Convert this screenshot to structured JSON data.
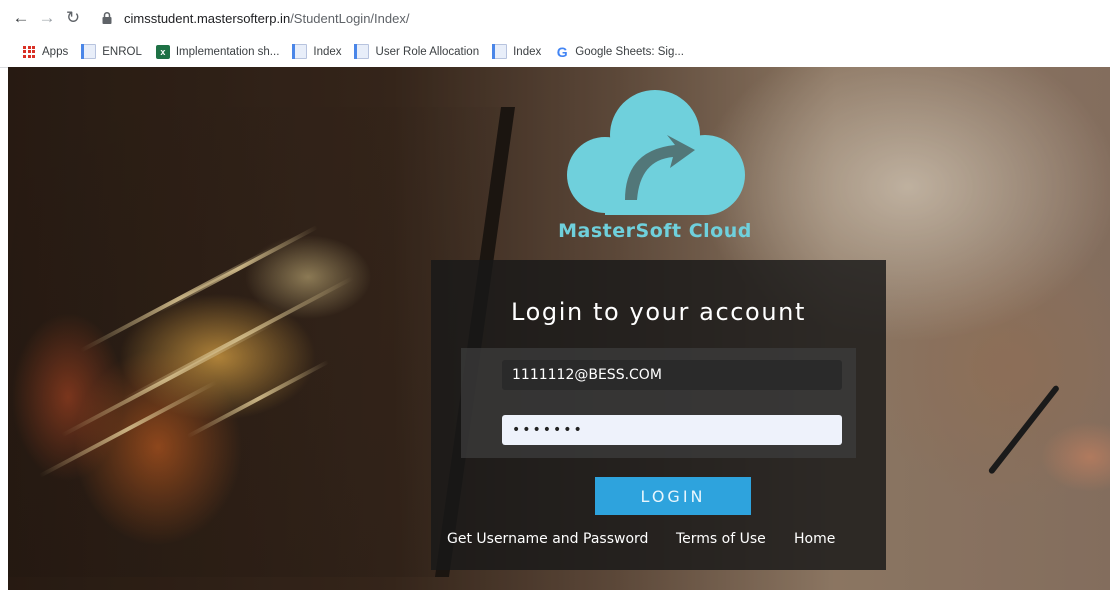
{
  "browser": {
    "url_host": "cimsstudent.mastersofterp.in",
    "url_path": "/StudentLogin/Index/"
  },
  "bookmarks": [
    {
      "label": "Apps",
      "icon": "apps-grid-icon"
    },
    {
      "label": "ENROL",
      "icon": "document-icon"
    },
    {
      "label": "Implementation sh...",
      "icon": "excel-icon"
    },
    {
      "label": "Index",
      "icon": "document-icon"
    },
    {
      "label": "User Role Allocation",
      "icon": "document-icon"
    },
    {
      "label": "Index",
      "icon": "document-icon"
    },
    {
      "label": "Google Sheets: Sig...",
      "icon": "google-icon"
    }
  ],
  "brand": {
    "name": "MasterSoft Cloud",
    "color": "#6fd0dc"
  },
  "login": {
    "title": "Login to your account",
    "username_value": "1111112@BESS.COM",
    "password_value": "•••••••",
    "button_label": "LOGIN",
    "button_color": "#2ea3dd",
    "links": {
      "get_credentials": "Get Username and Password",
      "terms": "Terms of Use",
      "home": "Home"
    }
  }
}
